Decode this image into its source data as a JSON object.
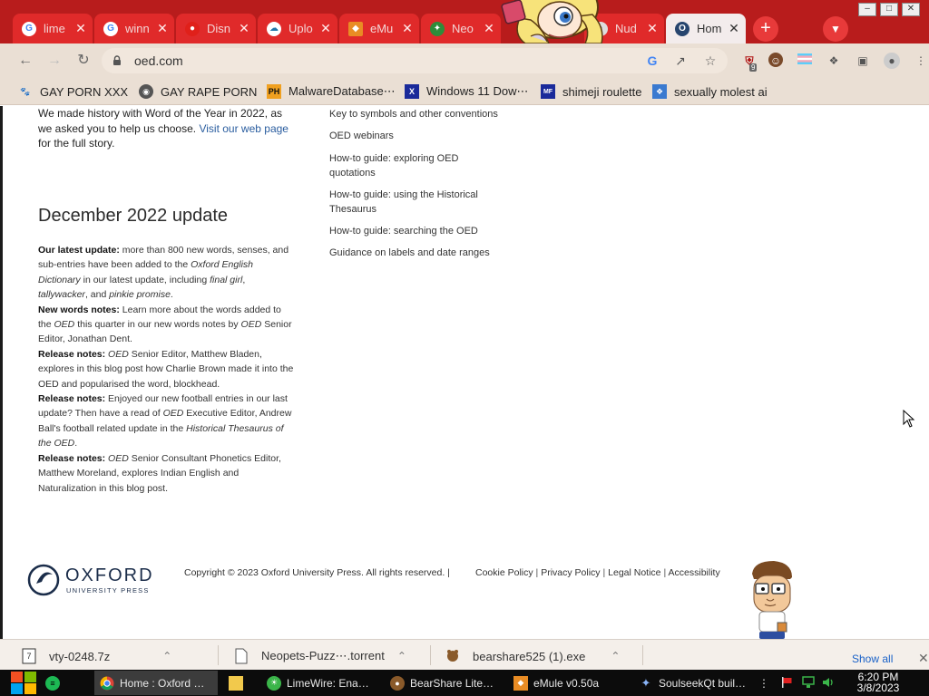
{
  "browser": {
    "tabs": [
      {
        "label": "lime",
        "favicon": "google-icon",
        "color": "#ffffff"
      },
      {
        "label": "winn",
        "favicon": "google-icon",
        "color": "#ffffff"
      },
      {
        "label": "Disn",
        "favicon": "fox-icon",
        "color": "#e0201a"
      },
      {
        "label": "Uplo",
        "favicon": "cloud-icon",
        "color": "#ffffff"
      },
      {
        "label": "eMu",
        "favicon": "emule-icon",
        "color": "#e98c24"
      },
      {
        "label": "Neo",
        "favicon": "neopets-icon",
        "color": "#2e8c3a"
      },
      {
        "label": "Nud",
        "favicon": "generic-icon",
        "color": "#dddddd"
      },
      {
        "label": "Hom",
        "favicon": "oed-icon",
        "color": "#27456e"
      }
    ],
    "url": "oed.com",
    "bookmarks": [
      {
        "label": "GAY PORN XXX",
        "icon": "paw-icon"
      },
      {
        "label": "GAY RAPE PORN",
        "icon": "globe-icon"
      },
      {
        "label": "MalwareDatabase⋯",
        "icon": "ph-icon",
        "icon_text": "PH"
      },
      {
        "label": "Windows 11 Dow⋯",
        "icon": "x-icon",
        "icon_text": "X"
      },
      {
        "label": "shimeji roulette",
        "icon": "mf-icon",
        "icon_text": "MF"
      },
      {
        "label": "sexually molest ai",
        "icon": "puzzle-icon"
      }
    ],
    "extension_badge": "9"
  },
  "page": {
    "intro_text_1": "We made history with Word of the Year in 2022, as we asked you to help us choose. ",
    "intro_link": "Visit our web page",
    "intro_text_2": " for the full story.",
    "update_heading": "December 2022 update",
    "p1_bold": "Our latest update:",
    "p1_a": " more than 800 new words, senses, and sub-entries have been added to the ",
    "p1_i1": "Oxford English Dictionary",
    "p1_b": " in our latest update, including ",
    "p1_i2": "final girl",
    "p1_c": ", ",
    "p1_i3": "tallywacker",
    "p1_d": ", and ",
    "p1_i4": "pinkie promise",
    "p1_e": ".",
    "p2_bold": "New words notes:",
    "p2_a": " Learn more about the words added to the ",
    "p2_i1": "OED",
    "p2_b": " this quarter in our new words notes by ",
    "p2_i2": "OED",
    "p2_c": " Senior Editor, Jonathan Dent.",
    "p3_bold": "Release notes:",
    "p3_a": " ",
    "p3_i1": "OED",
    "p3_b": " Senior Editor, Matthew Bladen, explores in this blog post how Charlie Brown made it into the OED and popularised the word, blockhead.",
    "p4_bold": "Release notes:",
    "p4_a": " Enjoyed our new football entries in our last update? Then have a read of ",
    "p4_i1": "OED",
    "p4_b": " Executive Editor, Andrew Ball's football related update in the ",
    "p4_i2": "Historical Thesaurus of the OED",
    "p4_c": ".",
    "p5_bold": "Release notes:",
    "p5_a": " ",
    "p5_i1": "OED",
    "p5_b": " Senior Consultant Phonetics Editor, Matthew Moreland, explores Indian English and Naturalization in this blog post.",
    "links": [
      "Key to symbols and other conventions",
      "OED webinars",
      "How-to guide: exploring OED quotations",
      "How-to guide: using the Historical Thesaurus",
      "How-to guide: searching the OED",
      "Guidance on labels and date ranges"
    ],
    "logo_title": "OXFORD",
    "logo_subtitle": "UNIVERSITY PRESS",
    "copyright": "Copyright © 2023 Oxford University Press. All rights reserved. |",
    "footer_links": [
      "Cookie Policy",
      "Privacy Policy",
      "Legal Notice",
      "Accessibility"
    ]
  },
  "downloads": {
    "items": [
      "vty-0248.7z",
      "Neopets-Puzz⋯.torrent",
      "bearshare525 (1).exe"
    ],
    "show_all": "Show all"
  },
  "taskbar": {
    "items": [
      {
        "label": "Home : Oxford …",
        "icon": "chrome-icon",
        "active": true
      },
      {
        "label": "",
        "icon": "folder-icon",
        "active": false
      },
      {
        "label": "LimeWire: Ena…",
        "icon": "limewire-icon",
        "active": false
      },
      {
        "label": "BearShare Lite…",
        "icon": "bearshare-icon",
        "active": false
      },
      {
        "label": "eMule v0.50a",
        "icon": "emule-icon",
        "active": false
      },
      {
        "label": "SoulseekQt buil…",
        "icon": "soulseek-icon",
        "active": false
      }
    ],
    "time": "6:20 PM",
    "date": "3/8/2023"
  },
  "colors": {
    "tab_strip": "#b81c1c",
    "tab": "#e02a2a",
    "toolbar": "#eadfd4",
    "link": "#2a5d9f",
    "oxford_navy": "#1b2d4a"
  }
}
